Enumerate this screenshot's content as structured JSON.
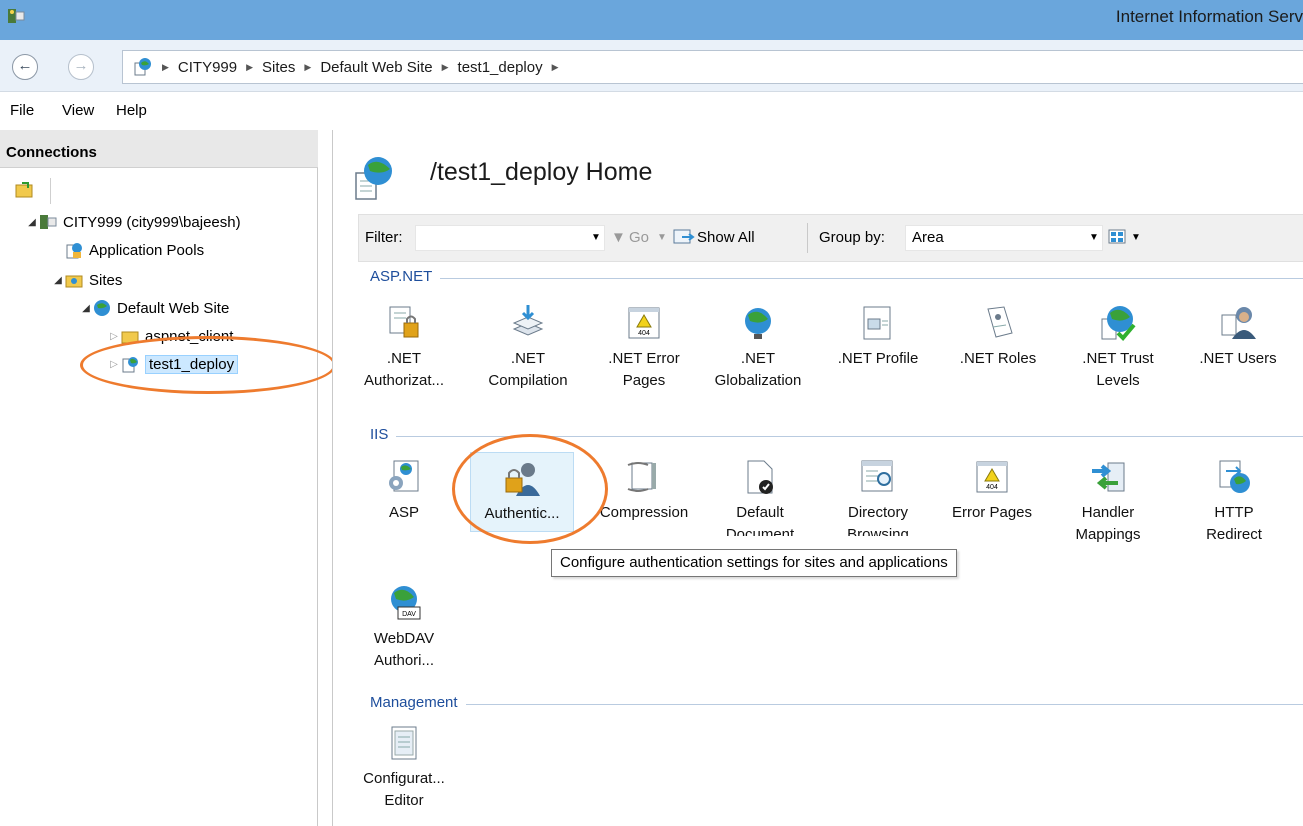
{
  "window": {
    "title": "Internet Information Serv"
  },
  "address": {
    "crumbs": [
      "CITY999",
      "Sites",
      "Default Web Site",
      "test1_deploy"
    ]
  },
  "menu": {
    "items": [
      "File",
      "View",
      "Help"
    ]
  },
  "connections": {
    "header": "Connections",
    "tree": {
      "server": "CITY999 (city999\\bajeesh)",
      "app_pools": "Application Pools",
      "sites": "Sites",
      "default_site": "Default Web Site",
      "aspnet_client": "aspnet_client",
      "test1_deploy": "test1_deploy"
    }
  },
  "main": {
    "title": "/test1_deploy Home",
    "filter": {
      "label": "Filter:",
      "go": "Go",
      "show_all": "Show All",
      "group_by_label": "Group by:",
      "group_by_value": "Area"
    },
    "groups": {
      "aspnet": {
        "label": "ASP.NET",
        "items": [
          {
            "l1": ".NET",
            "l2": "Authorizat..."
          },
          {
            "l1": ".NET",
            "l2": "Compilation"
          },
          {
            "l1": ".NET Error",
            "l2": "Pages"
          },
          {
            "l1": ".NET",
            "l2": "Globalization"
          },
          {
            "l1": ".NET Profile",
            "l2": ""
          },
          {
            "l1": ".NET Roles",
            "l2": ""
          },
          {
            "l1": ".NET Trust",
            "l2": "Levels"
          },
          {
            "l1": ".NET Users",
            "l2": ""
          }
        ]
      },
      "iis": {
        "label": "IIS",
        "items": [
          {
            "l1": "ASP",
            "l2": ""
          },
          {
            "l1": "Authentic...",
            "l2": ""
          },
          {
            "l1": "Compression",
            "l2": ""
          },
          {
            "l1": "Default",
            "l2": "Document"
          },
          {
            "l1": "Directory",
            "l2": "Browsing"
          },
          {
            "l1": "Error Pages",
            "l2": ""
          },
          {
            "l1": "Handler",
            "l2": "Mappings"
          },
          {
            "l1": "HTTP",
            "l2": "Redirect"
          },
          {
            "l1": "WebDAV",
            "l2": "Authori..."
          }
        ]
      },
      "management": {
        "label": "Management",
        "items": [
          {
            "l1": "Configurat...",
            "l2": "Editor"
          }
        ]
      }
    },
    "tooltip": "Configure authentication settings for sites and applications"
  },
  "colors": {
    "accent_annotation": "#ee7b2e",
    "titlebar": "#6aa6dc",
    "group_label": "#1e4e9c"
  }
}
